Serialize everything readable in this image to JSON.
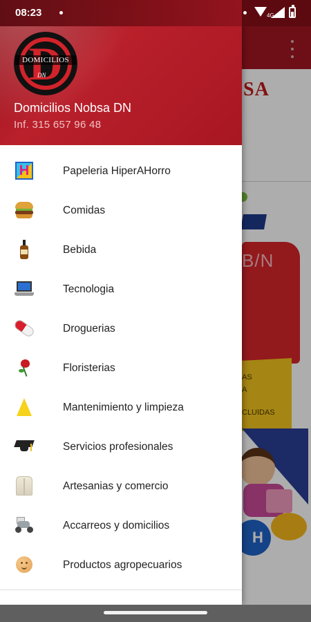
{
  "status_bar": {
    "time": "08:23",
    "network": "4G"
  },
  "background": {
    "partial_title": "SA",
    "tag_text": "B/N",
    "yellow_text_1": "AS",
    "yellow_text_2": "A",
    "yellow_text_3": "CLUIDAS",
    "h_badge": "H"
  },
  "drawer": {
    "logo_text": "DOMICILIOS",
    "logo_letter": "D",
    "logo_sub": "DN",
    "title": "Domicilios Nobsa DN",
    "subtitle": "Inf. 315 657 96 48",
    "items": [
      {
        "label": "Papeleria HiperAHorro",
        "icon": "hiperahorro-icon"
      },
      {
        "label": "Comidas",
        "icon": "burger-icon"
      },
      {
        "label": "Bebida",
        "icon": "bottle-icon"
      },
      {
        "label": "Tecnologia",
        "icon": "laptop-icon"
      },
      {
        "label": "Droguerias",
        "icon": "pill-icon"
      },
      {
        "label": "Floristerias",
        "icon": "rose-icon"
      },
      {
        "label": "Mantenimiento y limpieza",
        "icon": "wet-floor-sign-icon"
      },
      {
        "label": "Servicios profesionales",
        "icon": "graduation-cap-icon"
      },
      {
        "label": "Artesanias y comercio",
        "icon": "shawl-icon"
      },
      {
        "label": "Accarreos y domicilios",
        "icon": "delivery-motorcycle-icon"
      },
      {
        "label": "Productos agropecuarios",
        "icon": "potato-icon"
      }
    ]
  }
}
